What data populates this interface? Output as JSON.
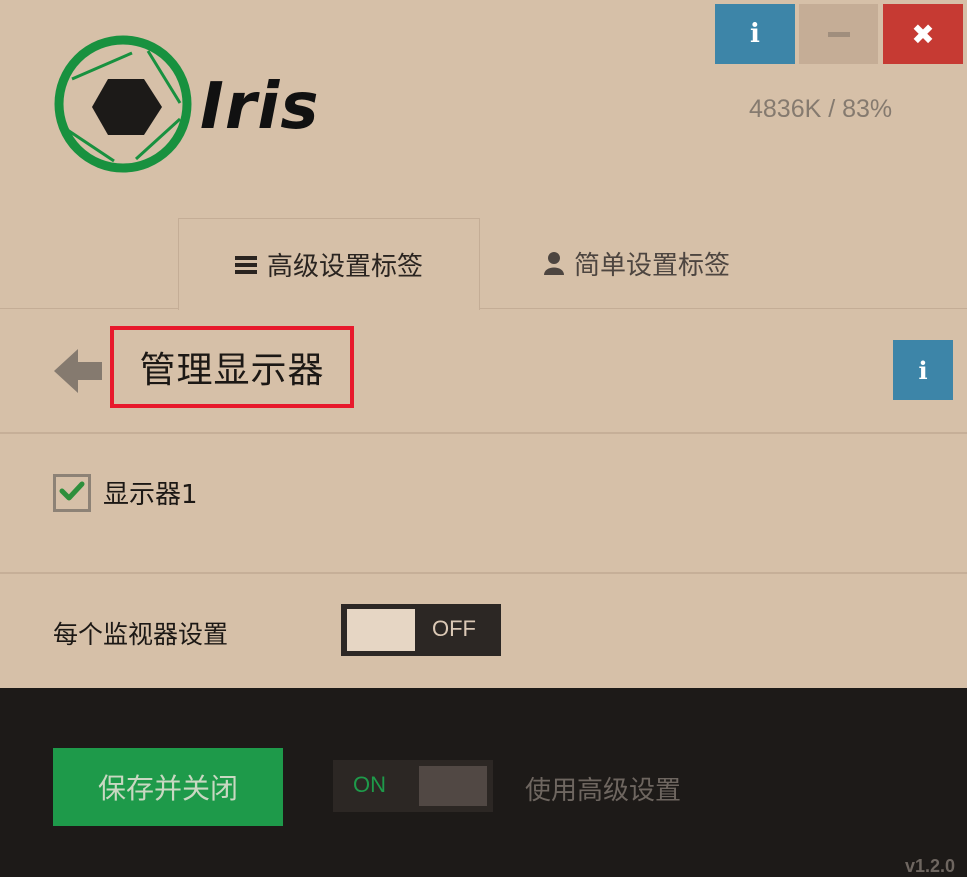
{
  "window": {
    "info_icon": "info-icon",
    "minimize_icon": "minimize-icon",
    "close_icon": "close-icon",
    "info_glyph": "i",
    "close_glyph": "✖"
  },
  "header": {
    "logo_text": "Iris",
    "mem_stats": "4836K / 83%"
  },
  "tabs": [
    {
      "label": "高级设置标签",
      "icon": "hamburger-icon",
      "active": true
    },
    {
      "label": "简单设置标签",
      "icon": "user-icon",
      "active": false
    }
  ],
  "section": {
    "title": "管理显示器",
    "info_glyph": "i"
  },
  "displays": [
    {
      "label": "显示器1",
      "checked": true
    }
  ],
  "per_monitor": {
    "label": "每个监视器设置",
    "toggle_text": "OFF"
  },
  "footer": {
    "save_close_label": "保存并关闭",
    "advanced_toggle_text": "ON",
    "advanced_label": "使用高级设置",
    "version": "v1.2.0"
  },
  "colors": {
    "background": "#d6c0a8",
    "info_blue": "#3d85a8",
    "close_red": "#c63a33",
    "accent_green": "#1e9a4a",
    "footer_dark": "#1d1a18",
    "highlight_red": "#e8192c"
  }
}
